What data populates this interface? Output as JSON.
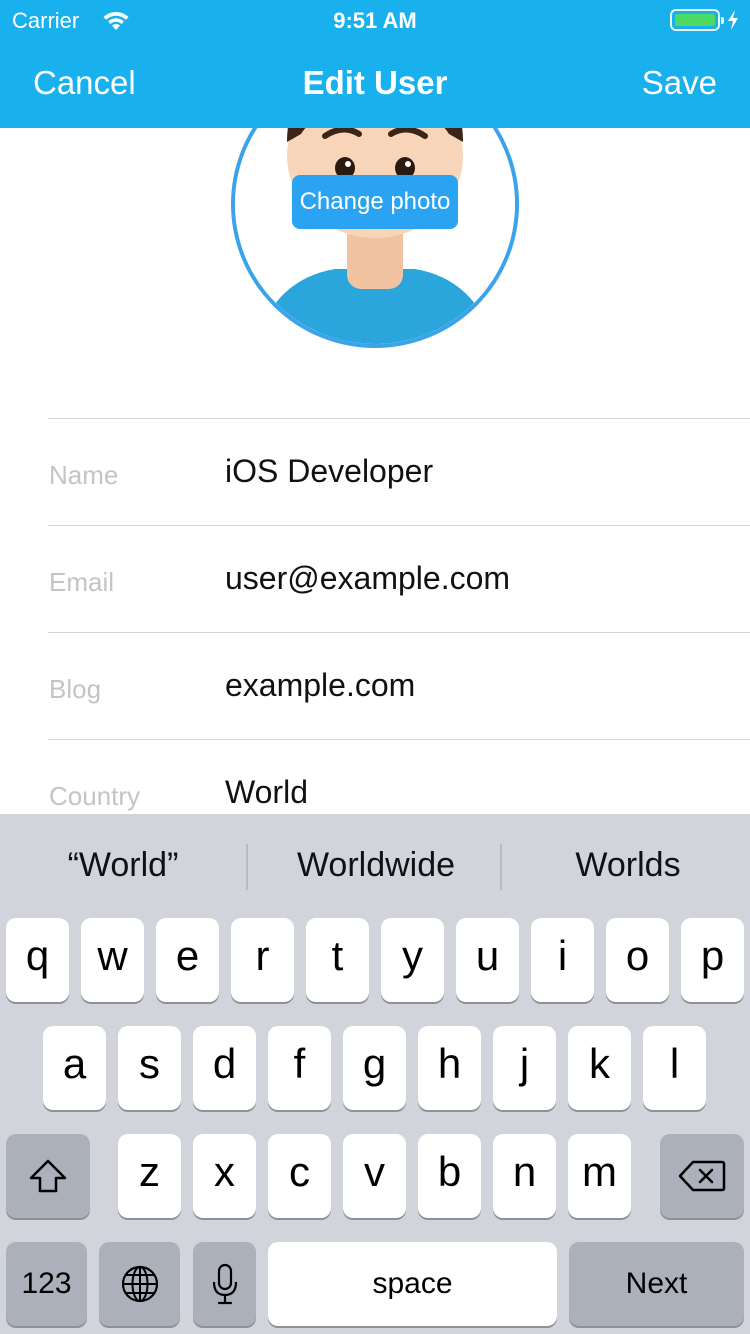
{
  "status_bar": {
    "carrier": "Carrier",
    "time": "9:51 AM",
    "battery_level": 1.0
  },
  "nav": {
    "cancel": "Cancel",
    "title": "Edit User",
    "save": "Save"
  },
  "avatar": {
    "change_photo": "Change photo"
  },
  "form": {
    "fields": [
      {
        "label": "Name",
        "value": "iOS Developer"
      },
      {
        "label": "Email",
        "value": "user@example.com"
      },
      {
        "label": "Blog",
        "value": "example.com"
      },
      {
        "label": "Country",
        "value": "World"
      }
    ]
  },
  "keyboard": {
    "suggestions": [
      "“World”",
      "Worldwide",
      "Worlds"
    ],
    "row1": [
      "q",
      "w",
      "e",
      "r",
      "t",
      "y",
      "u",
      "i",
      "o",
      "p"
    ],
    "row2": [
      "a",
      "s",
      "d",
      "f",
      "g",
      "h",
      "j",
      "k",
      "l"
    ],
    "row3": [
      "z",
      "x",
      "c",
      "v",
      "b",
      "n",
      "m"
    ],
    "numbers_key": "123",
    "space_key": "space",
    "next_key": "Next"
  },
  "colors": {
    "nav_bar": "#19b0ee",
    "accent": "#2aa3f3",
    "keyboard_bg": "#d2d4db"
  }
}
